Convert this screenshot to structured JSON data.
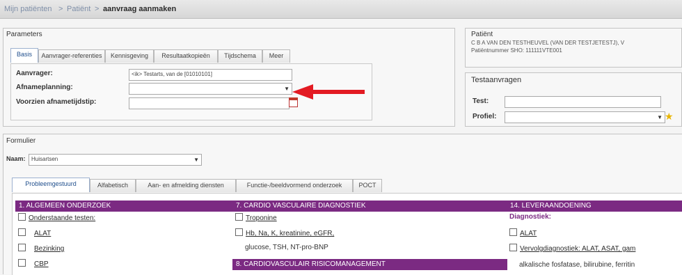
{
  "breadcrumb": {
    "part1": "Mijn patiënten",
    "sep1": ">",
    "part2": "Patiënt",
    "sep2": ">",
    "current": "aanvraag aanmaken"
  },
  "parameters": {
    "title": "Parameters",
    "tabs": [
      "Basis",
      "Aanvrager-referenties",
      "Kennisgeving",
      "Resultaatkopieën",
      "Tijdschema",
      "Meer"
    ],
    "aanvrager_label": "Aanvrager:",
    "aanvrager_value": "<ik> Testarts, van de [01010101]",
    "afnameplanning_label": "Afnameplanning:",
    "afnameplanning_value": "",
    "afnametijdstip_label": "Voorzien afnametijdstip:",
    "afnametijdstip_value": ""
  },
  "patient": {
    "title": "Patiënt",
    "name": "C B A VAN DEN TESTHEUVEL (VAN DER TESTJETESTJ), V",
    "number": "Patiëntnummer SHO: 111111VTE001"
  },
  "testaanvragen": {
    "title": "Testaanvragen",
    "test_label": "Test:",
    "profiel_label": "Profiel:"
  },
  "formulier": {
    "title": "Formulier",
    "naam_label": "Naam:",
    "naam_value": "Huisartsen",
    "tabs": [
      "Probleemgestuurd",
      "Alfabetisch",
      "Aan- en afmelding diensten",
      "Functie-/beeldvormend onderzoek",
      "POCT"
    ]
  },
  "columns": {
    "c1_head": "1. ALGEMEEN ONDERZOEK",
    "c1_items": [
      "Onderstaande testen:",
      "ALAT",
      "Bezinking",
      "CBP"
    ],
    "c2_head": "7. CARDIO VASCULAIRE DIAGNOSTIEK",
    "c2_items": [
      "Troponine",
      "Hb, Na, K, kreatinine, eGFR,",
      "glucose, TSH, NT-pro-BNP"
    ],
    "c2_head2": "8. CARDIOVASCULAIR RISICOMANAGEMENT",
    "c3_head": "14. LEVERAANDOENING",
    "c3_subhead": "Diagnostiek:",
    "c3_items": [
      "ALAT",
      "Vervolgdiagnostiek: ALAT, ASAT, gam",
      "alkalische fosfatase, bilirubine, ferritin"
    ]
  },
  "colors": {
    "accent_purple": "#7b2a82",
    "arrow_red": "#e31b23"
  }
}
